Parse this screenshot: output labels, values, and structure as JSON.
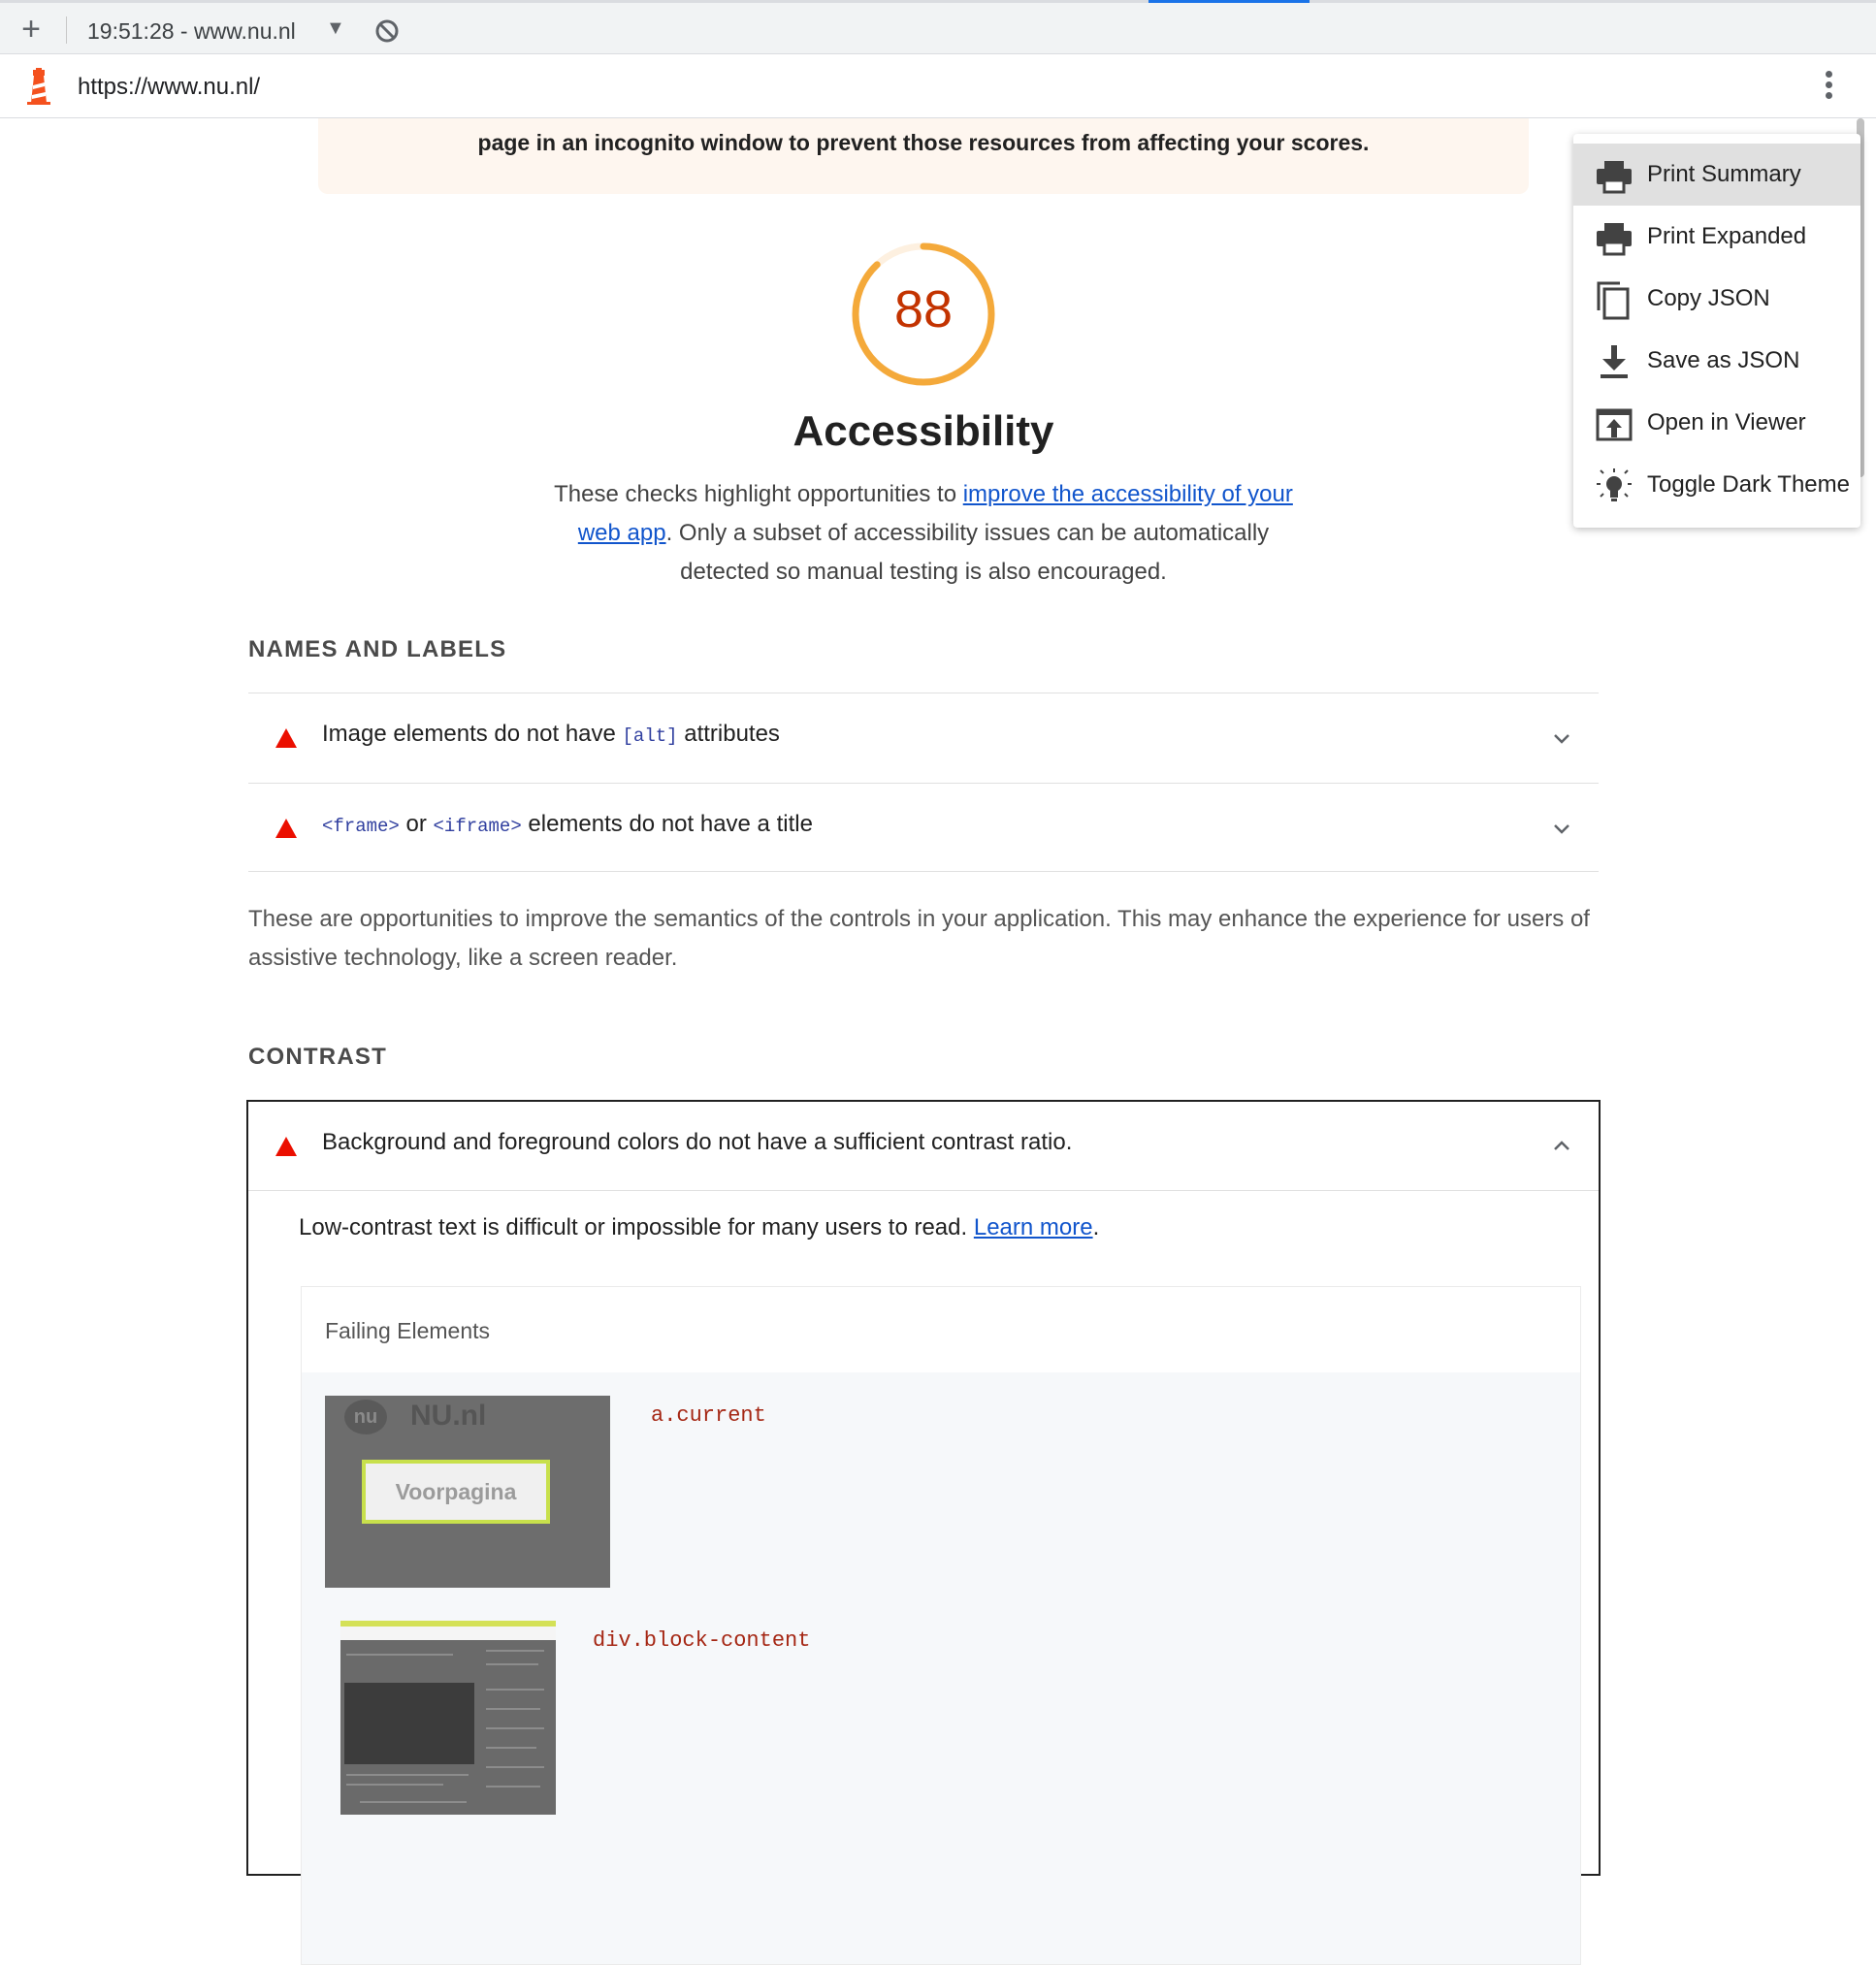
{
  "browser": {
    "tab_title": "19:51:28 - www.nu.nl",
    "url": "https://www.nu.nl/"
  },
  "warning": {
    "text": "page in an incognito window to prevent those resources from affecting your scores."
  },
  "category": {
    "score": "88",
    "title": "Accessibility",
    "desc_pre": "These checks highlight opportunities to ",
    "desc_link": "improve the accessibility of your web app",
    "desc_post": ". Only a subset of accessibility issues can be automatically detected so manual testing is also encouraged.",
    "gauge_color": "#f4a93a"
  },
  "groups": {
    "names_labels": {
      "title": "NAMES AND LABELS",
      "audits": [
        {
          "pre": "Image elements do not have ",
          "code": "[alt]",
          "post": " attributes"
        },
        {
          "code1": "<frame>",
          "mid": " or ",
          "code2": "<iframe>",
          "post": " elements do not have a title"
        }
      ],
      "description": "These are opportunities to improve the semantics of the controls in your application. This may enhance the experience for users of assistive technology, like a screen reader."
    },
    "contrast": {
      "title": "CONTRAST",
      "audit_title": "Background and foreground colors do not have a sufficient contrast ratio.",
      "desc_pre": "Low-contrast text is difficult or impossible for many users to read. ",
      "learn_more": "Learn more",
      "desc_post": ".",
      "failing_title": "Failing Elements",
      "elements": [
        {
          "selector": "a.current",
          "snippet_brand": "NU.nl",
          "snippet_logo": "nu",
          "snippet_label": "Voorpagina"
        },
        {
          "selector": "div.block-content"
        }
      ]
    }
  },
  "menu": {
    "items": [
      {
        "label": "Print Summary",
        "icon": "print-icon"
      },
      {
        "label": "Print Expanded",
        "icon": "print-icon"
      },
      {
        "label": "Copy JSON",
        "icon": "copy-icon"
      },
      {
        "label": "Save as JSON",
        "icon": "download-icon"
      },
      {
        "label": "Open in Viewer",
        "icon": "open-in-viewer-icon"
      },
      {
        "label": "Toggle Dark Theme",
        "icon": "lightbulb-icon"
      }
    ]
  },
  "colors": {
    "fail_red": "#eb0f00",
    "link_blue": "#1155cc",
    "score_orange": "#c33300"
  }
}
